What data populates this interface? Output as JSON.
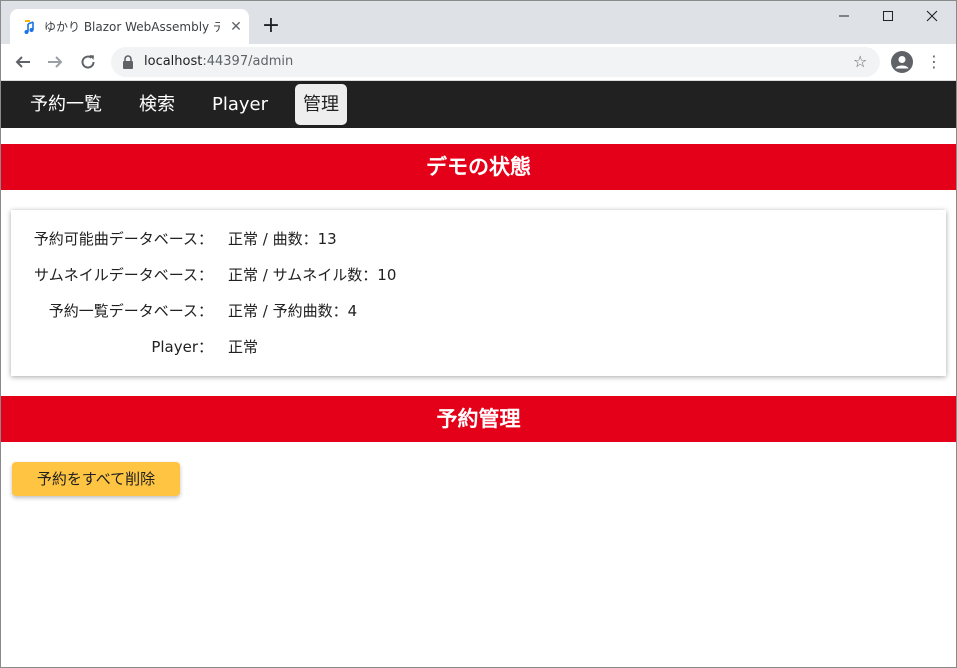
{
  "browser": {
    "tab_title": "ゆかり Blazor WebAssembly デモ",
    "url_host": "localhost",
    "url_port_path": ":44397/admin"
  },
  "nav": {
    "items": [
      {
        "label": "予約一覧"
      },
      {
        "label": "検索"
      },
      {
        "label": "Player"
      },
      {
        "label": "管理"
      }
    ]
  },
  "status_section": {
    "heading": "デモの状態",
    "rows": [
      {
        "label": "予約可能曲データベース：",
        "value": "正常 / 曲数：13"
      },
      {
        "label": "サムネイルデータベース：",
        "value": "正常 / サムネイル数：10"
      },
      {
        "label": "予約一覧データベース：",
        "value": "正常 / 予約曲数：4"
      },
      {
        "label": "Player：",
        "value": "正常"
      }
    ]
  },
  "reservation_section": {
    "heading": "予約管理",
    "delete_all_label": "予約をすべて削除"
  },
  "colors": {
    "nav_bg": "#212121",
    "heading_bg": "#e50019",
    "button_bg": "#ffc542"
  }
}
